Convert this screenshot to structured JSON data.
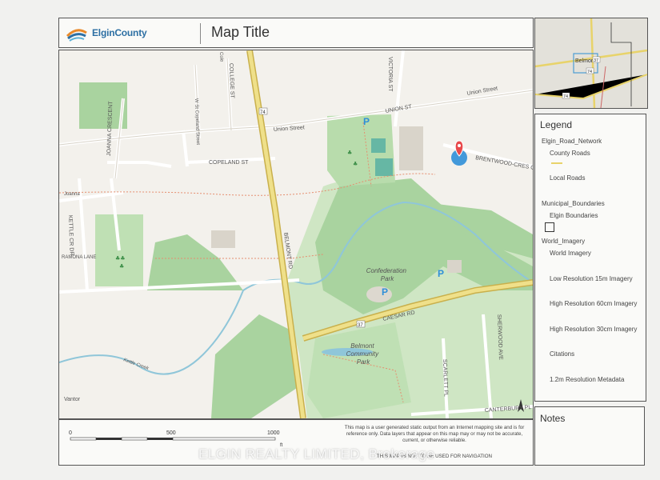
{
  "header": {
    "brand": "ElginCounty",
    "title": "Map Title"
  },
  "map": {
    "streets": {
      "union_st_e": "UNION ST",
      "union_street": "Union Street",
      "union_st_right": "Union Street",
      "college_st": "COLLEGE ST",
      "cole": "Cole",
      "victoria_st": "VICTORIA ST",
      "w_st_copeland": "W St Copeland Street",
      "copeland_st": "COPELAND ST",
      "joanna_crescent": "JOANNA CRESCENT",
      "joanna": "Joanna",
      "kettle_creek_dr": "KETTLE CR DR",
      "ramona_lane": "RAMONA LANE",
      "belmont_rd": "BELMONT RD",
      "brentwood": "BRENTWOOD-CRES C",
      "caesar_rd": "CAESAR RD",
      "scarlett_pl": "SCARLETT PL",
      "sherwood_ave": "SHERWOOD AVE",
      "canterbury_pl": "CANTERBURY PL",
      "hwy74": "74",
      "hwy37": "37"
    },
    "parks": {
      "confederation": "Confederation Park",
      "belmont_community": "Belmont Community Park"
    },
    "waterway": "Kettle Creek",
    "attribution": "Vantor"
  },
  "overview": {
    "town": "Belmont",
    "hwy74": "74",
    "hwy37": "37"
  },
  "legend": {
    "heading": "Legend",
    "items": [
      "Elgin_Road_Network",
      "County Roads",
      "Local Roads",
      "Municipal_Boundaries",
      "Elgin Boundaries",
      "World_Imagery",
      "World Imagery",
      "Low Resolution 15m Imagery",
      "High Resolution 60cm Imagery",
      "High Resolution 30cm Imagery",
      "Citations",
      "1.2m Resolution Metadata"
    ]
  },
  "notes": {
    "heading": "Notes"
  },
  "footer": {
    "scale_labels": [
      "0",
      "500",
      "1000"
    ],
    "scale_unit": "ft",
    "disclaimer": "This map is a user generated static output from an Internet mapping site and is for reference only. Data layers that appear on this map may or may not be accurate, current, or otherwise reliable.",
    "navigation": "THIS MAP IS NOT TO BE USED FOR NAVIGATION"
  },
  "watermark": "ELGIN REALTY LIMITED, Brokerage",
  "colors": {
    "park_green": "#cfe6c4",
    "woodland_green": "#a9d39f",
    "county_road": "#e8d36a",
    "water": "#8fc6d9",
    "location_pin": "#e8494b",
    "location_dot": "#2f8fd8"
  }
}
